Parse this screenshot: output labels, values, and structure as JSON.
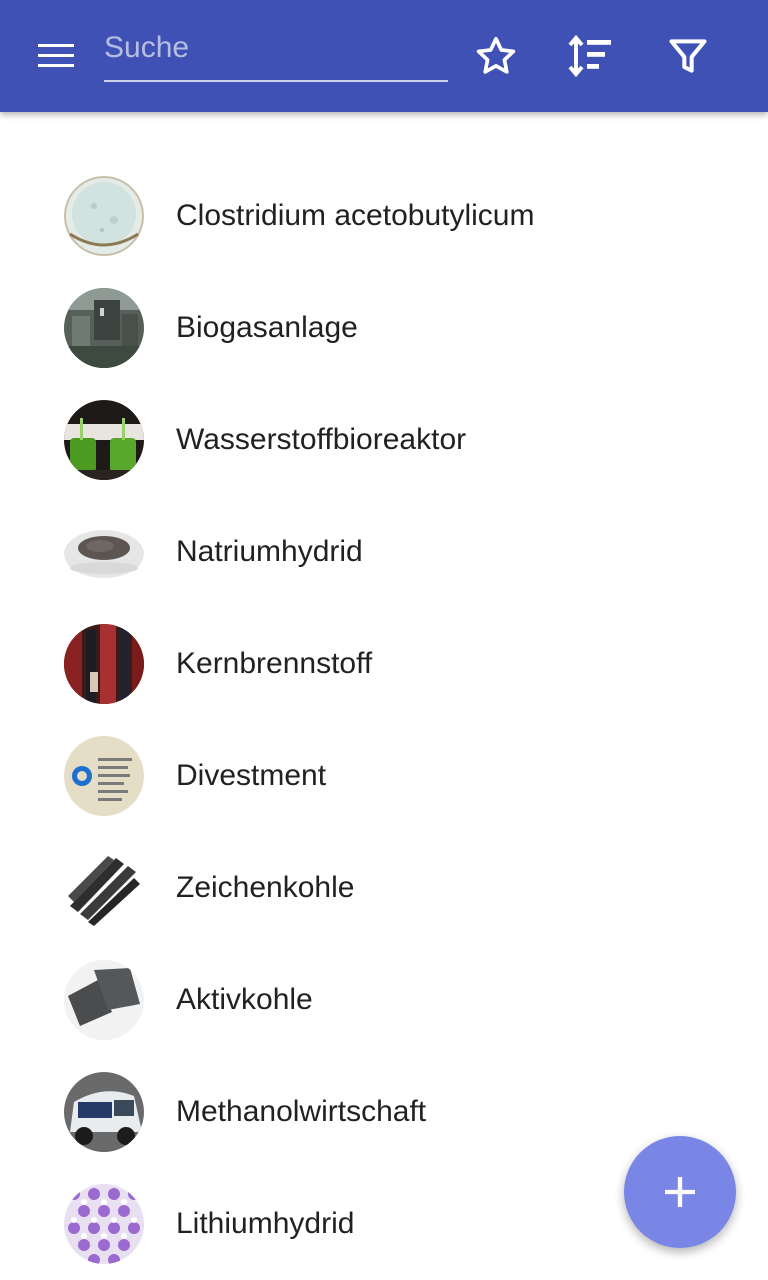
{
  "appbar": {
    "color": "#3f51b5",
    "menu_icon": "menu-icon",
    "search_placeholder": "Suche",
    "search_value": "",
    "actions": [
      "star-outline-icon",
      "sort-icon",
      "filter-icon"
    ]
  },
  "list": {
    "items": [
      {
        "label": "Clostridium acetobutylicum",
        "thumb": "petri-dish-photo"
      },
      {
        "label": "Biogasanlage",
        "thumb": "industrial-plant-photo"
      },
      {
        "label": "Wasserstoffbioreaktor",
        "thumb": "green-reactor-photo"
      },
      {
        "label": "Natriumhydrid",
        "thumb": "powder-dish-photo"
      },
      {
        "label": "Kernbrennstoff",
        "thumb": "fuel-rods-photo"
      },
      {
        "label": "Divestment",
        "thumb": "donut-chart-image"
      },
      {
        "label": "Zeichenkohle",
        "thumb": "charcoal-sticks-photo"
      },
      {
        "label": "Aktivkohle",
        "thumb": "activated-carbon-photo"
      },
      {
        "label": "Methanolwirtschaft",
        "thumb": "car-photo"
      },
      {
        "label": "Lithiumhydrid",
        "thumb": "crystal-lattice-image"
      }
    ]
  },
  "fab": {
    "icon": "add-icon",
    "color": "#7986e5"
  }
}
